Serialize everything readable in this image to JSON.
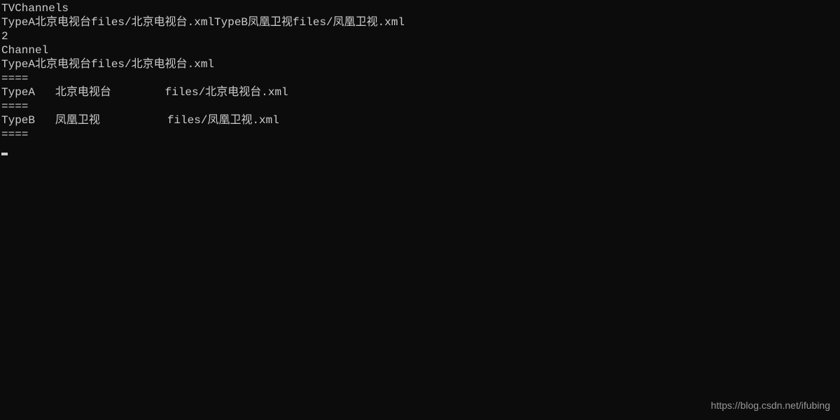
{
  "terminal": {
    "lines": [
      "TVChannels",
      "TypeA北京电视台files/北京电视台.xmlTypeB凤凰卫视files/凤凰卫视.xml",
      "2",
      "Channel",
      "TypeA北京电视台files/北京电视台.xml",
      "====",
      "TypeA   北京电视台        files/北京电视台.xml",
      "====",
      "TypeB   凤凰卫视          files/凤凰卫视.xml",
      "===="
    ]
  },
  "watermark": "https://blog.csdn.net/ifubing"
}
